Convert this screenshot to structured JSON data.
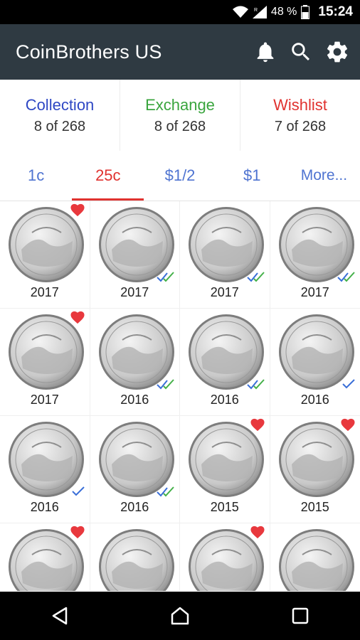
{
  "status_bar": {
    "battery_pct": "48 %",
    "time": "15:24",
    "icons": [
      "wifi-icon",
      "signal-icon",
      "battery-icon"
    ]
  },
  "app_bar": {
    "title": "CoinBrothers US",
    "actions": [
      "notification-bell-icon",
      "search-icon",
      "settings-gear-icon"
    ]
  },
  "summary": [
    {
      "label": "Collection",
      "count": "8 of 268",
      "color": "#2e47c4"
    },
    {
      "label": "Exchange",
      "count": "8 of 268",
      "color": "#3aa53e"
    },
    {
      "label": "Wishlist",
      "count": "7 of 268",
      "color": "#e0322f"
    }
  ],
  "tabs": [
    {
      "label": "1c",
      "active": false
    },
    {
      "label": "25c",
      "active": true
    },
    {
      "label": "$1/2",
      "active": false
    },
    {
      "label": "$1",
      "active": false
    },
    {
      "label": "More...",
      "active": false
    }
  ],
  "coins": [
    {
      "year": "2017",
      "mark": "wishlist"
    },
    {
      "year": "2017",
      "mark": "exchange"
    },
    {
      "year": "2017",
      "mark": "exchange"
    },
    {
      "year": "2017",
      "mark": "exchange"
    },
    {
      "year": "2017",
      "mark": "wishlist"
    },
    {
      "year": "2016",
      "mark": "exchange"
    },
    {
      "year": "2016",
      "mark": "exchange"
    },
    {
      "year": "2016",
      "mark": "collection"
    },
    {
      "year": "2016",
      "mark": "collection"
    },
    {
      "year": "2016",
      "mark": "exchange"
    },
    {
      "year": "2015",
      "mark": "wishlist"
    },
    {
      "year": "2015",
      "mark": "wishlist"
    },
    {
      "year": "",
      "mark": "wishlist"
    },
    {
      "year": "",
      "mark": "none"
    },
    {
      "year": "",
      "mark": "wishlist"
    },
    {
      "year": "",
      "mark": "none"
    }
  ],
  "colors": {
    "appbar": "#2f3a42",
    "heart": "#e8383d",
    "check_blue": "#3a6fd8",
    "check_green": "#45b14a"
  },
  "nav_bar": [
    "back-icon",
    "home-icon",
    "recents-icon"
  ]
}
